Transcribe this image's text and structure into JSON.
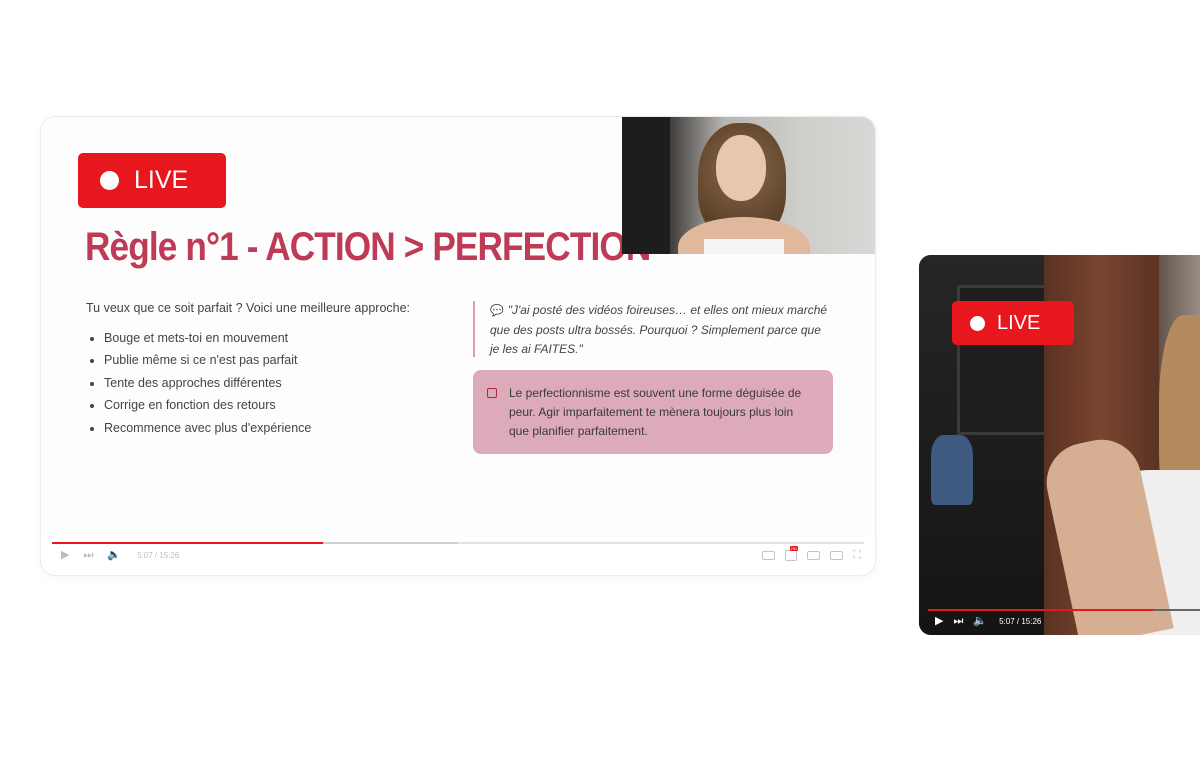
{
  "main_player": {
    "live_label": "LIVE",
    "slide_title": "Règle n°1 - ACTION > PERFECTION",
    "intro": "Tu veux que ce soit parfait ? Voici une meilleure approche:",
    "bullets": [
      "Bouge et mets-toi en mouvement",
      "Publie même si ce n'est pas parfait",
      "Tente des approches différentes",
      "Corrige en fonction des retours",
      "Recommence avec plus d'expérience"
    ],
    "quote_icon": "💬",
    "quote": "\"J'ai posté des vidéos foireuses… et elles ont mieux marché que des posts ultra bossés. Pourquoi ? Simplement parce que je les ai FAITES.\"",
    "note": "Le perfectionnisme est souvent une forme déguisée de peur. Agir imparfaitement te mènera toujours plus loin que planifier parfaitement.",
    "note_icon": "note-icon",
    "time": "5:07 / 15:26",
    "progress_fraction": 0.334,
    "buffer_fraction": 0.5,
    "accent_color": "#e8171d",
    "title_color": "#bf3a55",
    "note_color": "#dcaab9"
  },
  "side_player": {
    "live_label": "LIVE",
    "time": "5:07 / 15:26",
    "progress_fraction": 0.83
  }
}
